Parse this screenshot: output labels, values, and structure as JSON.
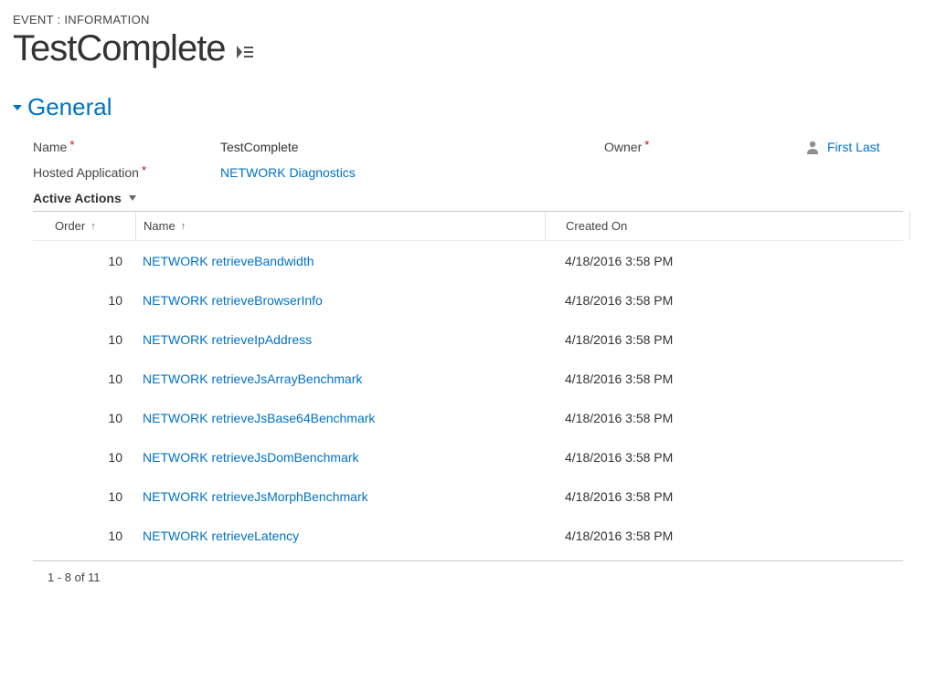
{
  "breadcrumb": "EVENT : INFORMATION",
  "title": "TestComplete",
  "section": "General",
  "form": {
    "name_label": "Name",
    "name_value": "TestComplete",
    "hostedapp_label": "Hosted Application",
    "hostedapp_value": "NETWORK Diagnostics",
    "owner_label": "Owner",
    "owner_value": "First Last"
  },
  "active_actions_label": "Active Actions",
  "columns": {
    "order": "Order",
    "name": "Name",
    "created": "Created On"
  },
  "rows": [
    {
      "order": "10",
      "name": "NETWORK retrieveBandwidth",
      "created": "4/18/2016 3:58 PM"
    },
    {
      "order": "10",
      "name": "NETWORK retrieveBrowserInfo",
      "created": "4/18/2016 3:58 PM"
    },
    {
      "order": "10",
      "name": "NETWORK retrieveIpAddress",
      "created": "4/18/2016 3:58 PM"
    },
    {
      "order": "10",
      "name": "NETWORK retrieveJsArrayBenchmark",
      "created": "4/18/2016 3:58 PM"
    },
    {
      "order": "10",
      "name": "NETWORK retrieveJsBase64Benchmark",
      "created": "4/18/2016 3:58 PM"
    },
    {
      "order": "10",
      "name": "NETWORK retrieveJsDomBenchmark",
      "created": "4/18/2016 3:58 PM"
    },
    {
      "order": "10",
      "name": "NETWORK retrieveJsMorphBenchmark",
      "created": "4/18/2016 3:58 PM"
    },
    {
      "order": "10",
      "name": "NETWORK retrieveLatency",
      "created": "4/18/2016 3:58 PM"
    }
  ],
  "paging": "1 - 8 of 11"
}
